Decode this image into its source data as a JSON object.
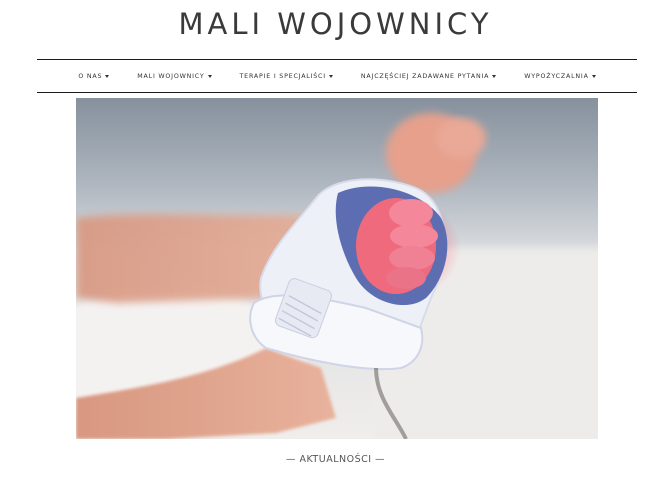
{
  "site": {
    "title": "MALI WOJOWNICY"
  },
  "nav": {
    "items": [
      {
        "label": "O NAS"
      },
      {
        "label": "MALI WOJOWNICY"
      },
      {
        "label": "TERAPIE I SPECJALIŚCI"
      },
      {
        "label": "NAJCZĘŚCIEJ ZADAWANE PYTANIA"
      },
      {
        "label": "WYPOŻYCZALNIA"
      }
    ]
  },
  "hero": {
    "icon": "baby-foot-with-pulse-oximeter-photo"
  },
  "section": {
    "title": "— AKTUALNOŚCI —"
  },
  "colors": {
    "text": "#333333",
    "rule": "#1c1c1c",
    "cuff": "#5f6fb5",
    "skin": "#e7a58f"
  }
}
